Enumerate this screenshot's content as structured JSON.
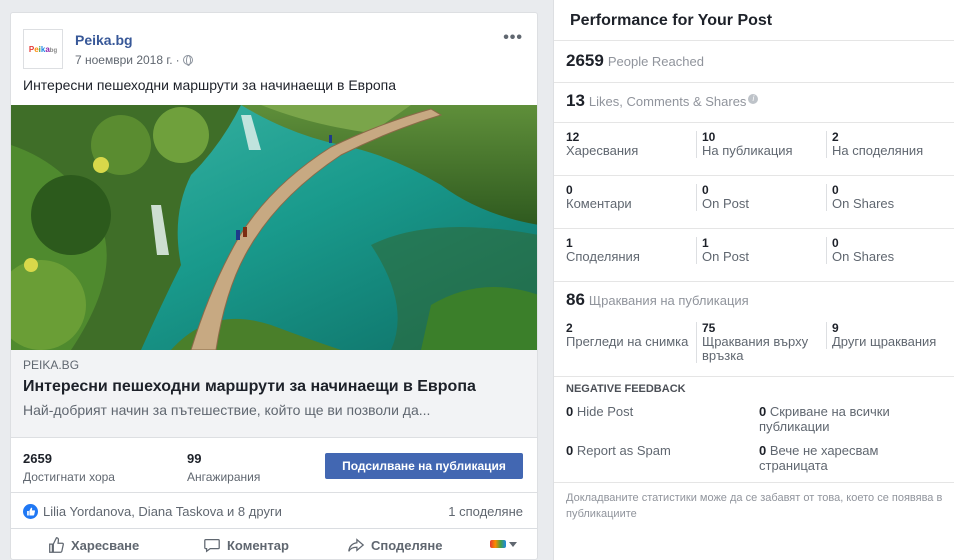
{
  "post": {
    "page_name": "Peika.bg",
    "logo_letters": [
      "P",
      "e",
      "i",
      "k",
      "a",
      "bg"
    ],
    "date": "7 ноември 2018 г.",
    "date_sep": "·",
    "more": "•••",
    "text": "Интересни пешеходни маршрути за начинаещи в Европа",
    "link": {
      "domain": "PEIKA.BG",
      "title": "Интересни пешеходни маршрути за начинаещи в Европа",
      "description": "Най-добрият начин за пътешествие, който ще ви позволи да..."
    },
    "stats": {
      "reached_value": "2659",
      "reached_label": "Достигнати хора",
      "engagement_value": "99",
      "engagement_label": "Ангажирания",
      "boost_label": "Подсилване на публикация"
    },
    "reactions": {
      "names": "Lilia Yordanova, Diana Taskova и 8 други",
      "shares": "1 споделяне"
    },
    "actions": {
      "like": "Харесване",
      "comment": "Коментар",
      "share": "Споделяне"
    }
  },
  "performance": {
    "title": "Performance for Your Post",
    "people_reached_value": "2659",
    "people_reached_label": "People Reached",
    "lcs_value": "13",
    "lcs_label": "Likes, Comments & Shares",
    "likes": [
      {
        "value": "12",
        "label": "Харесвания"
      },
      {
        "value": "10",
        "label": "На публикация"
      },
      {
        "value": "2",
        "label": "На споделяния"
      }
    ],
    "comments": [
      {
        "value": "0",
        "label": "Коментари"
      },
      {
        "value": "0",
        "label": "On Post"
      },
      {
        "value": "0",
        "label": "On Shares"
      }
    ],
    "shares": [
      {
        "value": "1",
        "label": "Споделяния"
      },
      {
        "value": "1",
        "label": "On Post"
      },
      {
        "value": "0",
        "label": "On Shares"
      }
    ],
    "clicks_value": "86",
    "clicks_label": "Щраквания на публикация",
    "clicks": [
      {
        "value": "2",
        "label": "Прегледи на снимка"
      },
      {
        "value": "75",
        "label": "Щраквания върху връзка"
      },
      {
        "value": "9",
        "label": "Други щраквания"
      }
    ],
    "negative_title": "NEGATIVE FEEDBACK",
    "negative": [
      {
        "value": "0",
        "label": "Hide Post"
      },
      {
        "value": "0",
        "label": "Скриване на всички публикации"
      },
      {
        "value": "0",
        "label": "Report as Spam"
      },
      {
        "value": "0",
        "label": "Вече не харесвам страницата"
      }
    ],
    "footnote": "Докладваните статистики може да се забавят от това, което се появява в публикациите"
  },
  "colors": {
    "brand_blue": "#4267b2",
    "link_blue": "#385898",
    "like_blue": "#2078f4"
  }
}
